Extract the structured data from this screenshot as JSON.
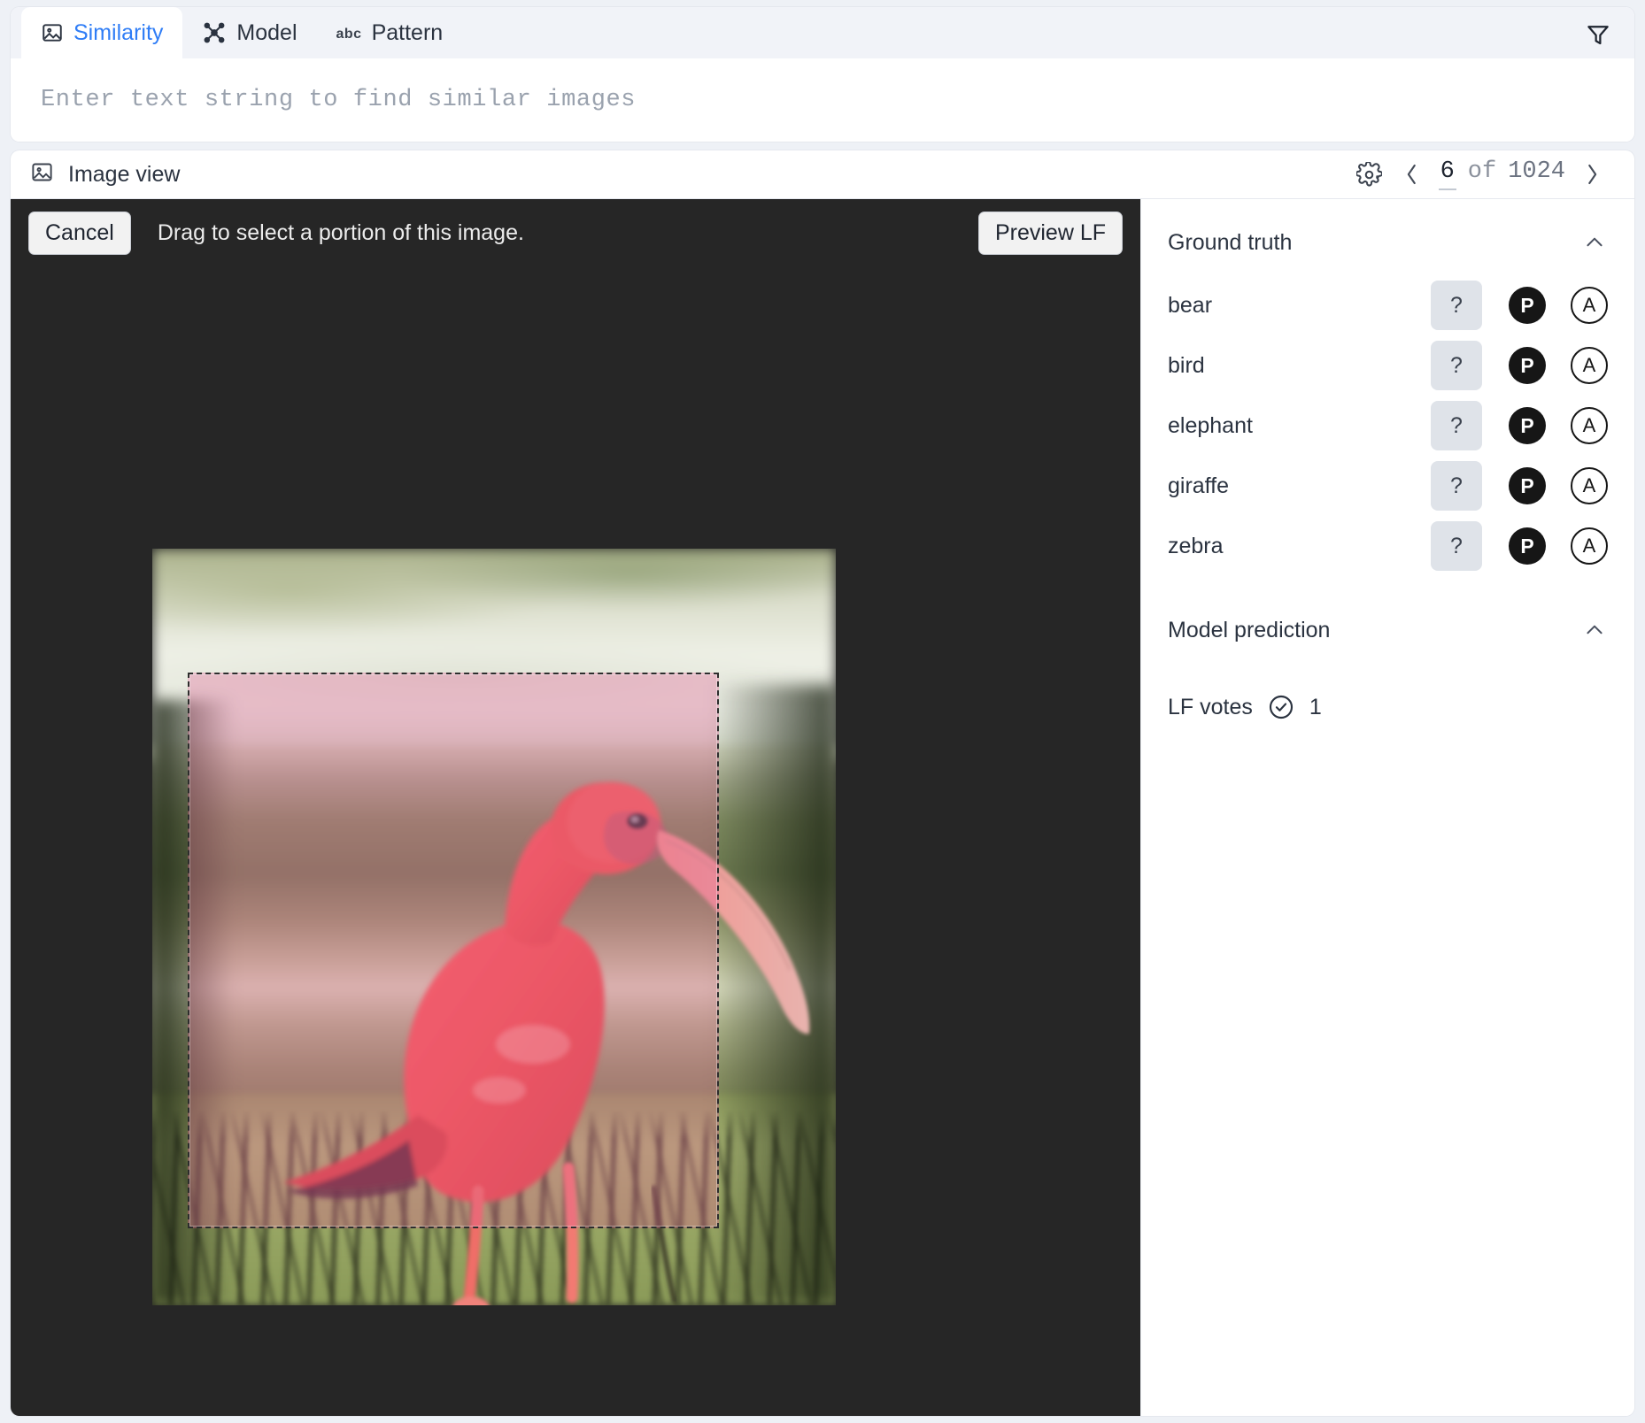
{
  "tabs": [
    {
      "id": "similarity",
      "label": "Similarity",
      "icon": "image-icon",
      "active": true
    },
    {
      "id": "model",
      "label": "Model",
      "icon": "model-graph-icon",
      "active": false
    },
    {
      "id": "pattern",
      "label": "Pattern",
      "icon": "abc-icon",
      "active": false
    }
  ],
  "filter": {
    "icon": "filter-funnel-icon"
  },
  "search": {
    "value": "",
    "placeholder": "Enter text string to find similar images"
  },
  "view": {
    "title": "Image view",
    "title_icon": "image-icon",
    "settings_icon": "gear-icon",
    "prev_icon": "chevron-left-icon",
    "next_icon": "chevron-right-icon",
    "current_page": "6",
    "of_label": "of",
    "total_pages": "1024"
  },
  "stage": {
    "cancel_label": "Cancel",
    "hint": "Drag to select a portion of this image.",
    "preview_label": "Preview LF",
    "selection_color": "#e26096",
    "background": "#262626"
  },
  "sidebar": {
    "ground_truth": {
      "title": "Ground truth",
      "collapse_icon": "chevron-up-icon",
      "rows": [
        {
          "label": "bear",
          "unknown": "?",
          "positive": "P",
          "abstain": "A"
        },
        {
          "label": "bird",
          "unknown": "?",
          "positive": "P",
          "abstain": "A"
        },
        {
          "label": "elephant",
          "unknown": "?",
          "positive": "P",
          "abstain": "A"
        },
        {
          "label": "giraffe",
          "unknown": "?",
          "positive": "P",
          "abstain": "A"
        },
        {
          "label": "zebra",
          "unknown": "?",
          "positive": "P",
          "abstain": "A"
        }
      ]
    },
    "model_prediction": {
      "title": "Model prediction",
      "collapse_icon": "chevron-up-icon",
      "lf_votes_label": "LF votes",
      "lf_votes_icon": "check-circle-icon",
      "lf_votes_count": "1"
    }
  }
}
